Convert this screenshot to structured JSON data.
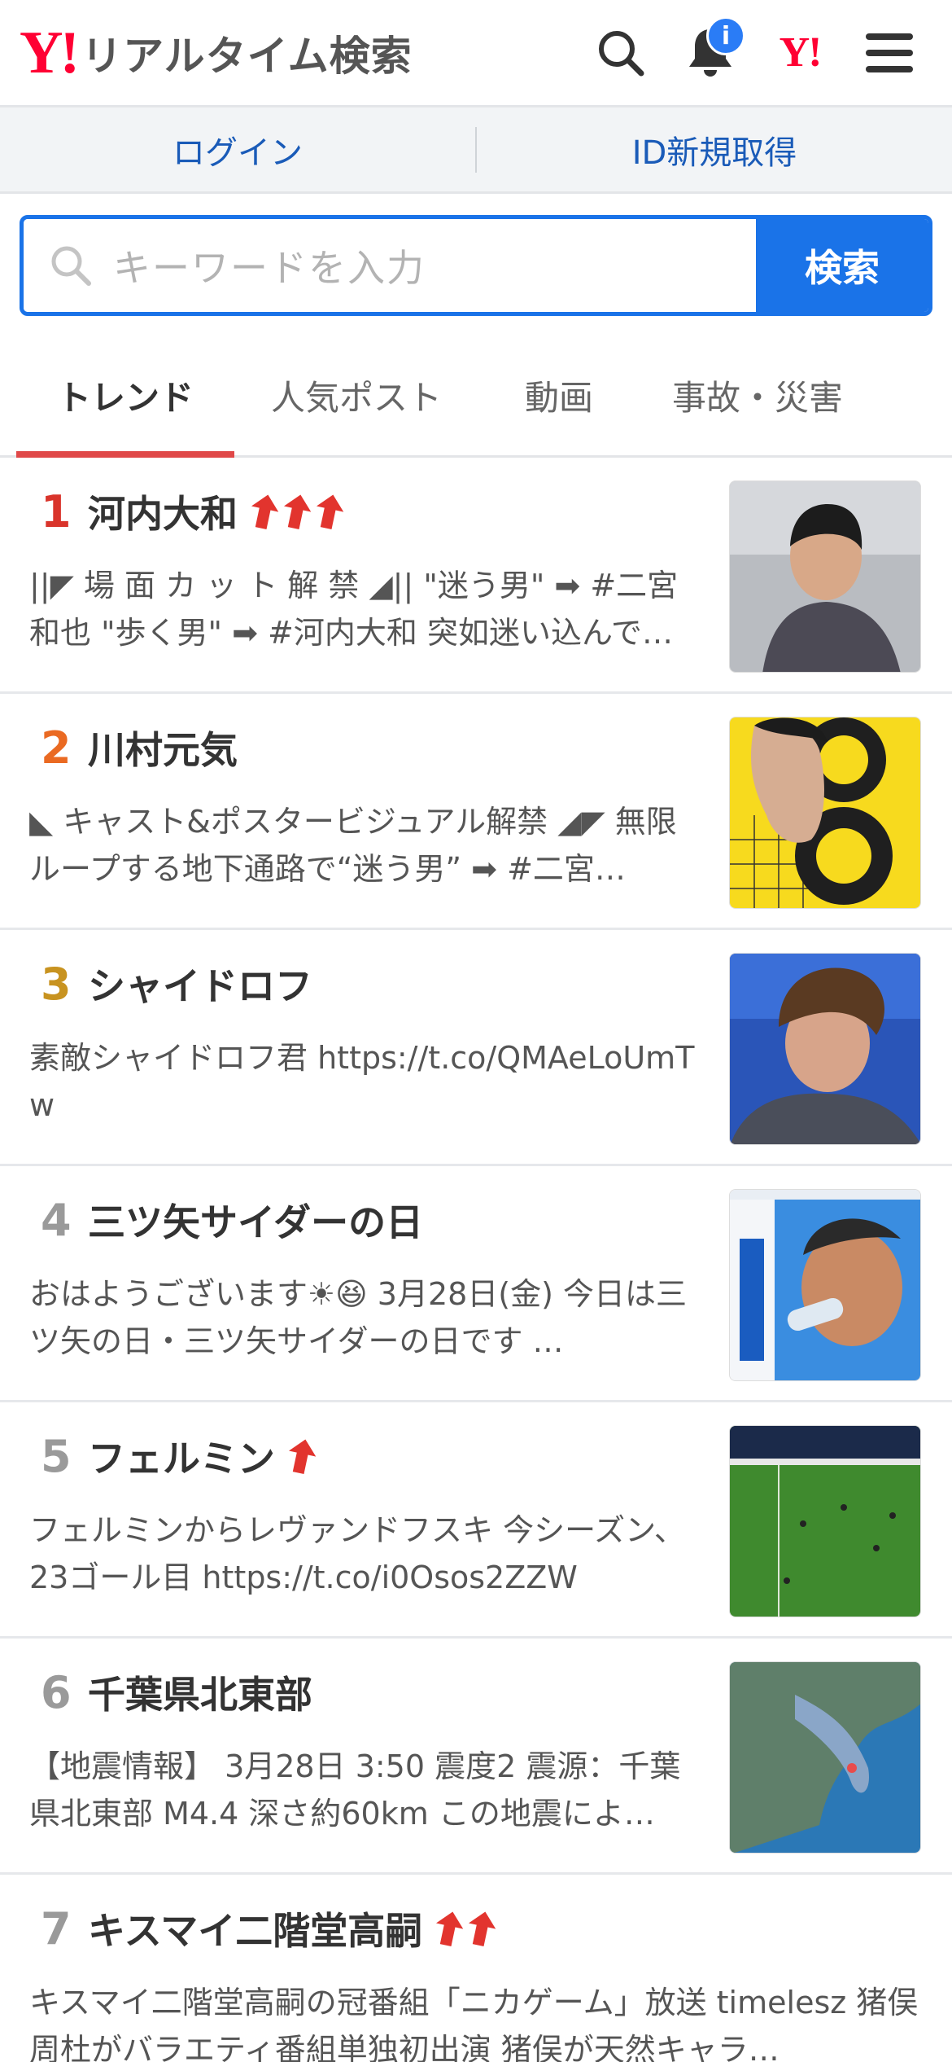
{
  "header": {
    "logo_mark": "Y!",
    "title": "リアルタイム検索",
    "notification_badge": "i",
    "yahoo_mark": "Y!"
  },
  "login": {
    "login_label": "ログイン",
    "signup_label": "ID新規取得"
  },
  "search": {
    "placeholder": "キーワードを入力",
    "button_label": "検索"
  },
  "tabs": [
    {
      "label": "トレンド",
      "active": true
    },
    {
      "label": "人気ポスト",
      "active": false
    },
    {
      "label": "動画",
      "active": false
    },
    {
      "label": "事故・災害",
      "active": false
    }
  ],
  "colors": {
    "accent": "#1a73e8",
    "active_tab": "#e04848",
    "rank1": "#d9342b",
    "rank2": "#ea6a22",
    "rank3": "#c89320",
    "rank_other": "#9a9a9a",
    "arrow": "#e2342e"
  },
  "items": [
    {
      "rank": "1",
      "title": "河内大和",
      "arrows": 3,
      "description": "||◤ 場 面 カ ッ ト 解 禁 ◢|| \"迷う男\" ➡ #二宮和也 \"歩く男\" ➡ #河内大和 突如迷い込んで…"
    },
    {
      "rank": "2",
      "title": "川村元気",
      "arrows": 0,
      "description": "◣ キャスト&ポスタービジュアル解禁 ◢◤ 無限ループする地下通路で“迷う男” ➡ #二宮…"
    },
    {
      "rank": "3",
      "title": "シャイドロフ",
      "arrows": 0,
      "description": "素敵シャイドロフ君 https://t.co/QMAeLoUmTw"
    },
    {
      "rank": "4",
      "title": "三ツ矢サイダーの日",
      "arrows": 0,
      "description": "おはようございます☀😆  3月28日(金)  今日は三ツ矢の日・三ツ矢サイダーの日です  …"
    },
    {
      "rank": "5",
      "title": "フェルミン",
      "arrows": 1,
      "description": "フェルミンからレヴァンドフスキ  今シーズン、23ゴール目 https://t.co/i0Osos2ZZW"
    },
    {
      "rank": "6",
      "title": "千葉県北東部",
      "arrows": 0,
      "description": "【地震情報】 3月28日 3:50 震度2 震源：千葉県北東部 M4.4 深さ約60km この地震によ…"
    },
    {
      "rank": "7",
      "title": "キスマイ二階堂高嗣",
      "arrows": 2,
      "description": "キスマイ二階堂高嗣の冠番組「ニカゲーム」放送 timelesz 猪俣周杜がバラエティ番組単独初出演 猪俣が天然キャラ…"
    }
  ]
}
